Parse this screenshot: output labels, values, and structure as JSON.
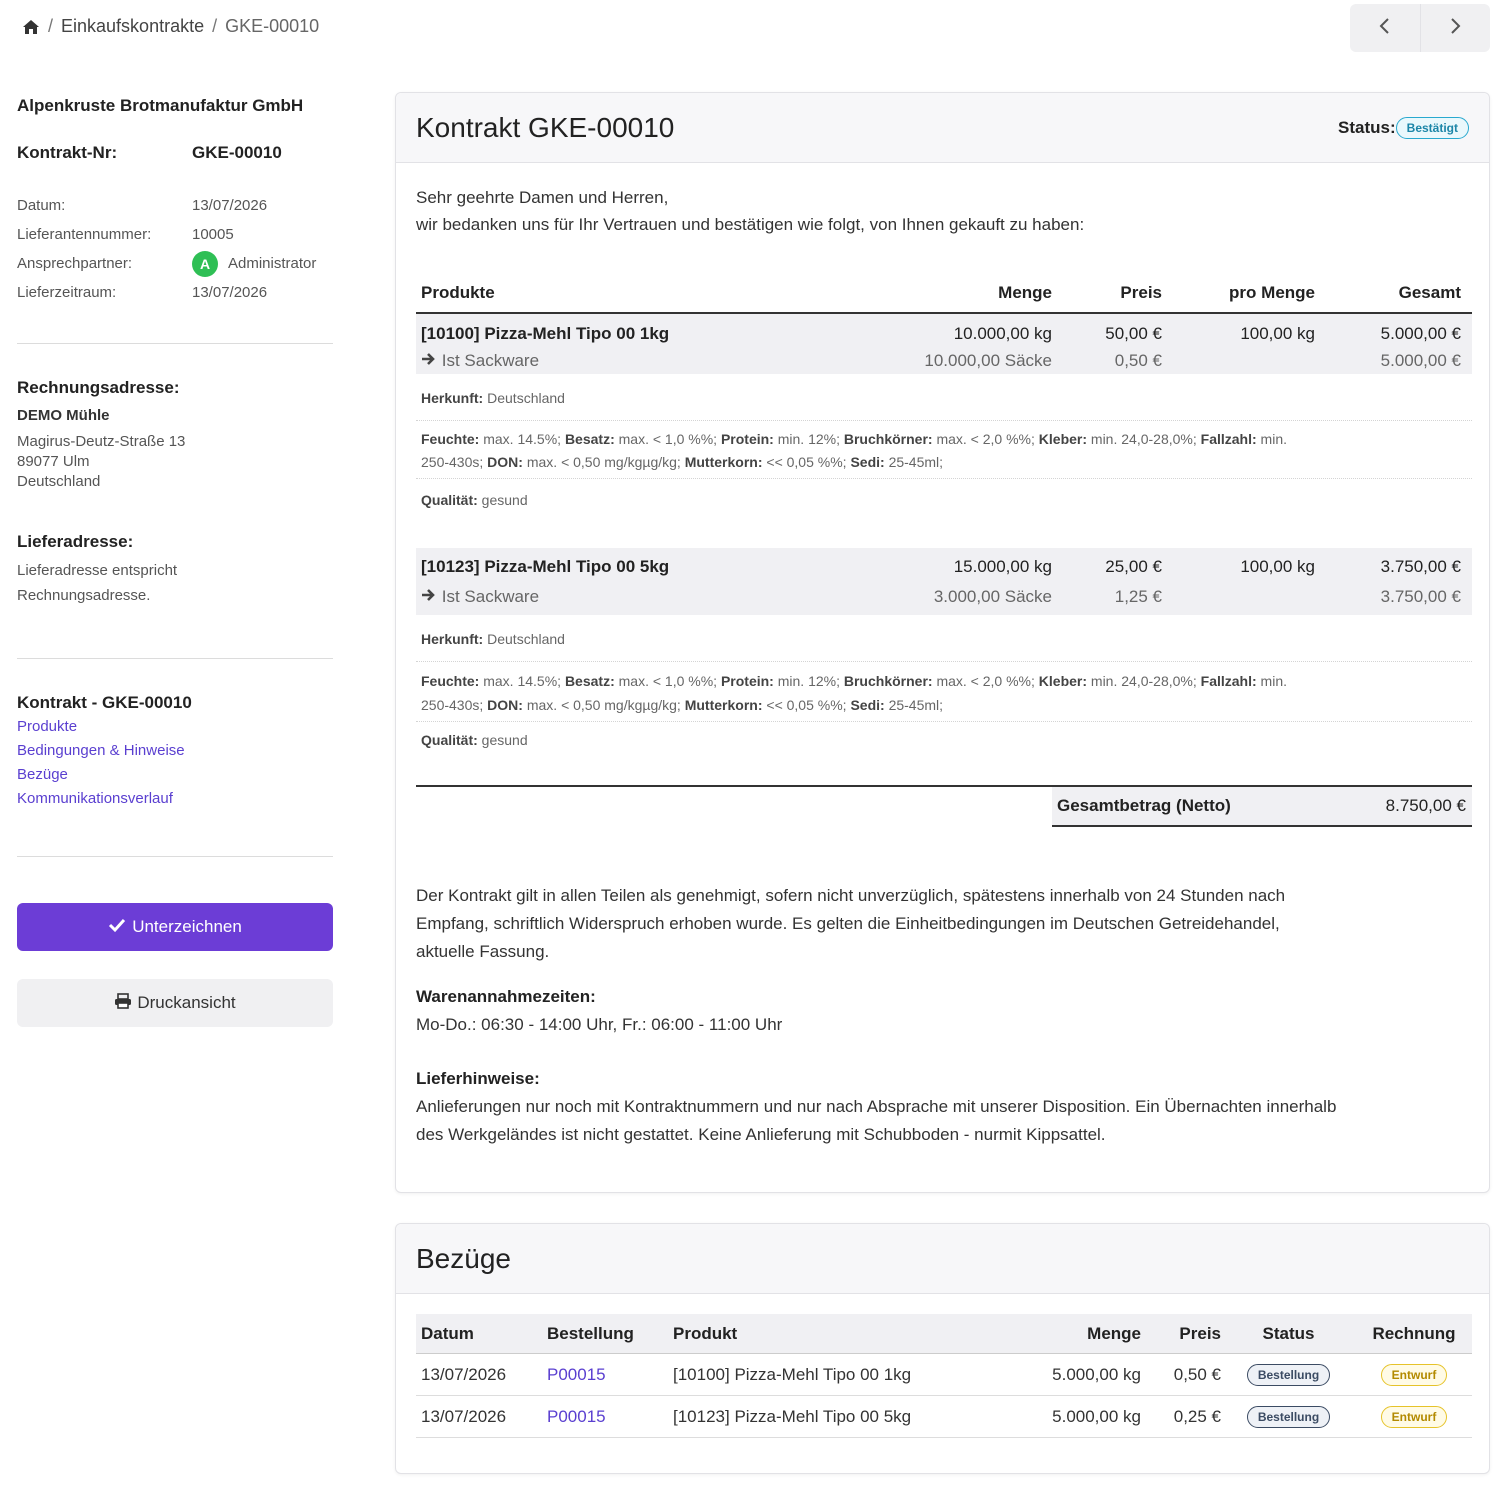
{
  "breadcrumb": {
    "home_icon": "home-icon",
    "section": "Einkaufskontrakte",
    "current": "GKE-00010"
  },
  "pager": {
    "prev_icon": "chevron-left-icon",
    "next_icon": "chevron-right-icon"
  },
  "sidebar": {
    "company": "Alpenkruste Brotmanufaktur GmbH",
    "contract_label": "Kontrakt-Nr:",
    "contract_value": "GKE-00010",
    "fields": {
      "date_label": "Datum:",
      "date_value": "13/07/2026",
      "supplier_label": "Lieferantennummer:",
      "supplier_value": "10005",
      "contact_label": "Ansprechpartner:",
      "contact_initial": "A",
      "contact_value": "Administrator",
      "period_label": "Lieferzeitraum:",
      "period_value": "13/07/2026"
    },
    "billing": {
      "heading": "Rechnungsadresse:",
      "name": "DEMO Mühle",
      "street": "Magirus-Deutz-Straße 13",
      "city": "89077 Ulm",
      "country": "Deutschland"
    },
    "delivery": {
      "heading": "Lieferadresse:",
      "line1": "Lieferadresse entspricht",
      "line2": "Rechnungsadresse."
    },
    "nav": {
      "heading": "Kontrakt - GKE-00010",
      "items": [
        "Produkte",
        "Bedingungen & Hinweise",
        "Bezüge",
        "Kommunikationsverlauf"
      ]
    },
    "sign_label": "Unterzeichnen",
    "print_label": "Druckansicht",
    "accent": "#6c3dd6"
  },
  "contract": {
    "title": "Kontrakt GKE-00010",
    "status_label": "Status:",
    "status_value": "Bestätigt",
    "greeting": "Sehr geehrte Damen und Herren,",
    "intro": "wir bedanken uns für Ihr Vertrauen und bestätigen wie folgt, von Ihnen gekauft zu haben:",
    "headers": {
      "product": "Produkte",
      "qty": "Menge",
      "price": "Preis",
      "per": "pro Menge",
      "total": "Gesamt"
    },
    "products": [
      {
        "name": "[10100] Pizza-Mehl Tipo 00 1kg",
        "qty": "10.000,00 kg",
        "price": "50,00 €",
        "per": "100,00 kg",
        "total": "5.000,00 €",
        "sub_name": "Ist Sackware",
        "sub_qty": "10.000,00 Säcke",
        "sub_price": "0,50 €",
        "sub_total": "5.000,00 €",
        "origin_label": "Herkunft:",
        "origin": "Deutschland",
        "spec_1": {
          "k1": "Feuchte:",
          "v1": " max. 14.5%; ",
          "k2": "Besatz:",
          "v2": " max. < 1,0 %%; ",
          "k3": "Protein:",
          "v3": " min. 12%; ",
          "k4": "Bruchkörner:",
          "v4": " max. < 2,0 %%; ",
          "k5": "Kleber:",
          "v5": " min. 24,0-28,0%; ",
          "k6": "Fallzahl:",
          "v6": " min."
        },
        "spec_2": {
          "v0": "250-430s; ",
          "k1": "DON:",
          "v1": " max. < 0,50 mg/kgµg/kg; ",
          "k2": "Mutterkorn:",
          "v2": " << 0,05 %%; ",
          "k3": "Sedi:",
          "v3": " 25-45ml;"
        },
        "quality_label": "Qualität:",
        "quality": "gesund"
      },
      {
        "name": "[10123] Pizza-Mehl Tipo 00 5kg",
        "qty": "15.000,00 kg",
        "price": "25,00 €",
        "per": "100,00 kg",
        "total": "3.750,00 €",
        "sub_name": "Ist Sackware",
        "sub_qty": "3.000,00 Säcke",
        "sub_price": "1,25 €",
        "sub_total": "3.750,00 €",
        "origin_label": "Herkunft:",
        "origin": "Deutschland",
        "spec_1": {
          "k1": "Feuchte:",
          "v1": " max. 14.5%; ",
          "k2": "Besatz:",
          "v2": " max. < 1,0 %%; ",
          "k3": "Protein:",
          "v3": " min. 12%; ",
          "k4": "Bruchkörner:",
          "v4": " max. < 2,0 %%; ",
          "k5": "Kleber:",
          "v5": " min. 24,0-28,0%; ",
          "k6": "Fallzahl:",
          "v6": " min."
        },
        "spec_2": {
          "v0": "250-430s; ",
          "k1": "DON:",
          "v1": " max. < 0,50 mg/kgµg/kg; ",
          "k2": "Mutterkorn:",
          "v2": " << 0,05 %%; ",
          "k3": "Sedi:",
          "v3": " 25-45ml;"
        },
        "quality_label": "Qualität:",
        "quality": "gesund"
      }
    ],
    "total_label": "Gesamtbetrag (Netto)",
    "total_value": "8.750,00 €",
    "terms_1": "Der Kontrakt gilt in allen Teilen als genehmigt, sofern nicht unverzüglich, spätestens innerhalb von 24 Stunden nach",
    "terms_2": "Empfang, schriftlich Widerspruch erhoben wurde. Es gelten die Einheitbedingungen im Deutschen Getreidehandel,",
    "terms_3": "aktuelle Fassung.",
    "hours_heading": "Warenannahmezeiten:",
    "hours": "Mo-Do.: 06:30 - 14:00 Uhr, Fr.: 06:00 - 11:00 Uhr",
    "delivery_heading": "Lieferhinweise:",
    "delivery_1": "Anlieferungen nur noch mit Kontraktnummern und nur nach Absprache mit unserer Disposition. Ein Übernachten innerhalb",
    "delivery_2": "des Werkgeländes ist nicht gestattet. Keine Anlieferung mit Schubboden - nurmit Kippsattel."
  },
  "bezuege": {
    "title": "Bezüge",
    "headers": {
      "date": "Datum",
      "order": "Bestellung",
      "product": "Produkt",
      "qty": "Menge",
      "price": "Preis",
      "status": "Status",
      "invoice": "Rechnung"
    },
    "rows": [
      {
        "date": "13/07/2026",
        "order": "P00015",
        "product": "[10100] Pizza-Mehl Tipo 00 1kg",
        "qty": "5.000,00 kg",
        "price": "0,50 €",
        "status": "Bestellung",
        "invoice": "Entwurf"
      },
      {
        "date": "13/07/2026",
        "order": "P00015",
        "product": "[10123] Pizza-Mehl Tipo 00 5kg",
        "qty": "5.000,00 kg",
        "price": "0,25 €",
        "status": "Bestellung",
        "invoice": "Entwurf"
      }
    ]
  }
}
